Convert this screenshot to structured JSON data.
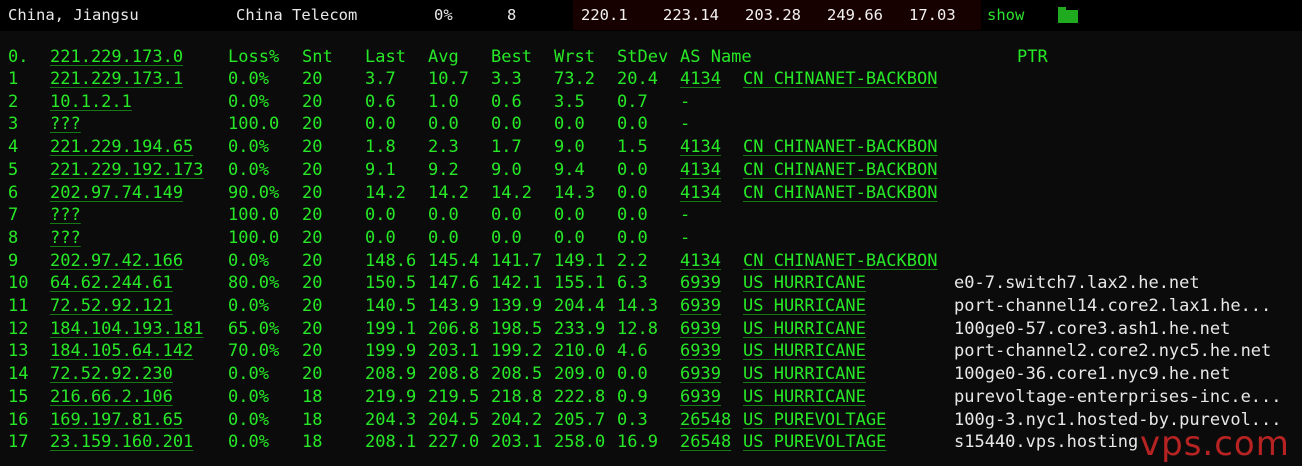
{
  "summary": {
    "location": "China, Jiangsu",
    "isp": "China Telecom",
    "loss": "0%",
    "count": "8",
    "last": "220.1",
    "avg": "223.14",
    "best": "203.28",
    "worst": "249.66",
    "stdev": "17.03",
    "show_label": "show",
    "colors": {
      "cell_bg": "#160000",
      "text_green": "#27e827",
      "text_white": "#e8e8e8"
    }
  },
  "table": {
    "headers": {
      "idx": "0.",
      "host": "221.229.173.0",
      "loss": "Loss%",
      "snt": "Snt",
      "last": "Last",
      "avg": "Avg",
      "best": "Best",
      "wrst": "Wrst",
      "stdev": "StDev",
      "as": "AS Name",
      "ptr": "PTR"
    },
    "rows": [
      {
        "idx": "1",
        "host": "221.229.173.1",
        "loss": "0.0%",
        "snt": "20",
        "last": "3.7",
        "avg": "10.7",
        "best": "3.3",
        "wrst": "73.2",
        "stdev": "20.4",
        "asn": "4134",
        "asname": "CN CHINANET-BACKBON",
        "ptr": ""
      },
      {
        "idx": "2",
        "host": "10.1.2.1",
        "loss": "0.0%",
        "snt": "20",
        "last": "0.6",
        "avg": "1.0",
        "best": "0.6",
        "wrst": "3.5",
        "stdev": "0.7",
        "asn": "-",
        "asname": "",
        "ptr": ""
      },
      {
        "idx": "3",
        "host": "???",
        "loss": "100.0",
        "snt": "20",
        "last": "0.0",
        "avg": "0.0",
        "best": "0.0",
        "wrst": "0.0",
        "stdev": "0.0",
        "asn": "-",
        "asname": "",
        "ptr": ""
      },
      {
        "idx": "4",
        "host": "221.229.194.65",
        "loss": "0.0%",
        "snt": "20",
        "last": "1.8",
        "avg": "2.3",
        "best": "1.7",
        "wrst": "9.0",
        "stdev": "1.5",
        "asn": "4134",
        "asname": "CN CHINANET-BACKBON",
        "ptr": ""
      },
      {
        "idx": "5",
        "host": "221.229.192.173",
        "loss": "0.0%",
        "snt": "20",
        "last": "9.1",
        "avg": "9.2",
        "best": "9.0",
        "wrst": "9.4",
        "stdev": "0.0",
        "asn": "4134",
        "asname": "CN CHINANET-BACKBON",
        "ptr": ""
      },
      {
        "idx": "6",
        "host": "202.97.74.149",
        "loss": "90.0%",
        "snt": "20",
        "last": "14.2",
        "avg": "14.2",
        "best": "14.2",
        "wrst": "14.3",
        "stdev": "0.0",
        "asn": "4134",
        "asname": "CN CHINANET-BACKBON",
        "ptr": ""
      },
      {
        "idx": "7",
        "host": "???",
        "loss": "100.0",
        "snt": "20",
        "last": "0.0",
        "avg": "0.0",
        "best": "0.0",
        "wrst": "0.0",
        "stdev": "0.0",
        "asn": "-",
        "asname": "",
        "ptr": ""
      },
      {
        "idx": "8",
        "host": "???",
        "loss": "100.0",
        "snt": "20",
        "last": "0.0",
        "avg": "0.0",
        "best": "0.0",
        "wrst": "0.0",
        "stdev": "0.0",
        "asn": "-",
        "asname": "",
        "ptr": ""
      },
      {
        "idx": "9",
        "host": "202.97.42.166",
        "loss": "0.0%",
        "snt": "20",
        "last": "148.6",
        "avg": "145.4",
        "best": "141.7",
        "wrst": "149.1",
        "stdev": "2.2",
        "asn": "4134",
        "asname": "CN CHINANET-BACKBON",
        "ptr": ""
      },
      {
        "idx": "10",
        "host": "64.62.244.61",
        "loss": "80.0%",
        "snt": "20",
        "last": "150.5",
        "avg": "147.6",
        "best": "142.1",
        "wrst": "155.1",
        "stdev": "6.3",
        "asn": "6939",
        "asname": "US HURRICANE",
        "ptr": "e0-7.switch7.lax2.he.net"
      },
      {
        "idx": "11",
        "host": "72.52.92.121",
        "loss": "0.0%",
        "snt": "20",
        "last": "140.5",
        "avg": "143.9",
        "best": "139.9",
        "wrst": "204.4",
        "stdev": "14.3",
        "asn": "6939",
        "asname": "US HURRICANE",
        "ptr": "port-channel14.core2.lax1.he..."
      },
      {
        "idx": "12",
        "host": "184.104.193.181",
        "loss": "65.0%",
        "snt": "20",
        "last": "199.1",
        "avg": "206.8",
        "best": "198.5",
        "wrst": "233.9",
        "stdev": "12.8",
        "asn": "6939",
        "asname": "US HURRICANE",
        "ptr": "100ge0-57.core3.ash1.he.net"
      },
      {
        "idx": "13",
        "host": "184.105.64.142",
        "loss": "70.0%",
        "snt": "20",
        "last": "199.9",
        "avg": "203.1",
        "best": "199.2",
        "wrst": "210.0",
        "stdev": "4.6",
        "asn": "6939",
        "asname": "US HURRICANE",
        "ptr": "port-channel2.core2.nyc5.he.net"
      },
      {
        "idx": "14",
        "host": "72.52.92.230",
        "loss": "0.0%",
        "snt": "20",
        "last": "208.9",
        "avg": "208.8",
        "best": "208.5",
        "wrst": "209.0",
        "stdev": "0.0",
        "asn": "6939",
        "asname": "US HURRICANE",
        "ptr": "100ge0-36.core1.nyc9.he.net"
      },
      {
        "idx": "15",
        "host": "216.66.2.106",
        "loss": "0.0%",
        "snt": "18",
        "last": "219.9",
        "avg": "219.5",
        "best": "218.8",
        "wrst": "222.8",
        "stdev": "0.9",
        "asn": "6939",
        "asname": "US HURRICANE",
        "ptr": "purevoltage-enterprises-inc.e..."
      },
      {
        "idx": "16",
        "host": "169.197.81.65",
        "loss": "0.0%",
        "snt": "18",
        "last": "204.3",
        "avg": "204.5",
        "best": "204.2",
        "wrst": "205.7",
        "stdev": "0.3",
        "asn": "26548",
        "asname": "US PUREVOLTAGE",
        "ptr": "100g-3.nyc1.hosted-by.purevol..."
      },
      {
        "idx": "17",
        "host": "23.159.160.201",
        "loss": "0.0%",
        "snt": "18",
        "last": "208.1",
        "avg": "227.0",
        "best": "203.1",
        "wrst": "258.0",
        "stdev": "16.9",
        "asn": "26548",
        "asname": "US PUREVOLTAGE",
        "ptr": "s15440.vps.hosting"
      }
    ]
  },
  "watermark": "vps.com"
}
